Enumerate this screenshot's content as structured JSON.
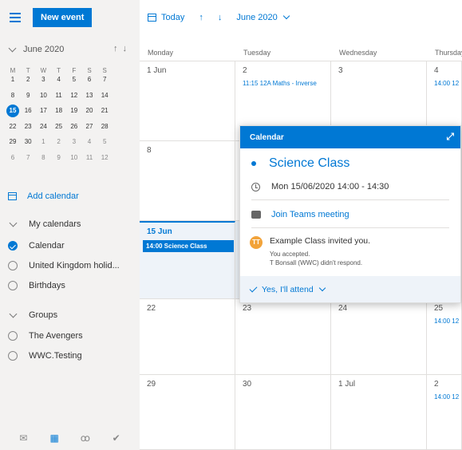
{
  "left": {
    "new_event": "New event",
    "mini_calendar": {
      "month_label": "June 2020",
      "weekdays": [
        "M",
        "T",
        "W",
        "T",
        "F",
        "S",
        "S"
      ],
      "weeks": [
        [
          "1",
          "2",
          "3",
          "4",
          "5",
          "6",
          "7"
        ],
        [
          "8",
          "9",
          "10",
          "11",
          "12",
          "13",
          "14"
        ],
        [
          "15",
          "16",
          "17",
          "18",
          "19",
          "20",
          "21"
        ],
        [
          "22",
          "23",
          "24",
          "25",
          "26",
          "27",
          "28"
        ],
        [
          "29",
          "30",
          "1",
          "2",
          "3",
          "4",
          "5"
        ],
        [
          "6",
          "7",
          "8",
          "9",
          "10",
          "11",
          "12"
        ]
      ],
      "today": "15"
    },
    "add_calendar": "Add calendar",
    "my_calendars_header": "My calendars",
    "calendars": [
      {
        "label": "Calendar",
        "checked": true
      },
      {
        "label": "United Kingdom holid...",
        "checked": false
      },
      {
        "label": "Birthdays",
        "checked": false
      }
    ],
    "groups_header": "Groups",
    "groups": [
      {
        "label": "The Avengers"
      },
      {
        "label": "WWC.Testing"
      }
    ],
    "footer_icons": [
      "mail-icon",
      "calendar-icon",
      "people-icon",
      "tasks-icon"
    ]
  },
  "toolbar": {
    "today_label": "Today",
    "month_label": "June 2020"
  },
  "grid": {
    "day_headers": [
      "Monday",
      "Tuesday",
      "Wednesday",
      "Thursday"
    ],
    "weeks": [
      {
        "days": [
          "1 Jun",
          "2",
          "3",
          "4"
        ],
        "events": {
          "1": "11:15 12A Maths - Inverse",
          "3": "14:00 12"
        }
      },
      {
        "days": [
          "8",
          "",
          "",
          ""
        ],
        "events": {}
      },
      {
        "days": [
          "15 Jun",
          "",
          "",
          ""
        ],
        "events": {
          "0": "14:00 Science Class"
        }
      },
      {
        "days": [
          "22",
          "23",
          "24",
          "25"
        ],
        "events": {
          "3": "14:00 12"
        }
      },
      {
        "days": [
          "29",
          "30",
          "1 Jul",
          "2"
        ],
        "events": {
          "3": "14:00 12"
        }
      }
    ]
  },
  "popup": {
    "header": "Calendar",
    "title": "Science Class",
    "datetime": "Mon 15/06/2020 14:00 - 14:30",
    "teams_link": "Join Teams meeting",
    "avatar_initials": "TT",
    "invite_text": "Example Class invited you.",
    "accepted": "You accepted.",
    "no_response": "T Bonsall (WWC) didn't respond.",
    "rsvp": "Yes, I'll attend"
  },
  "colors": {
    "accent": "#0078d4",
    "avatar": "#f2a33a"
  }
}
